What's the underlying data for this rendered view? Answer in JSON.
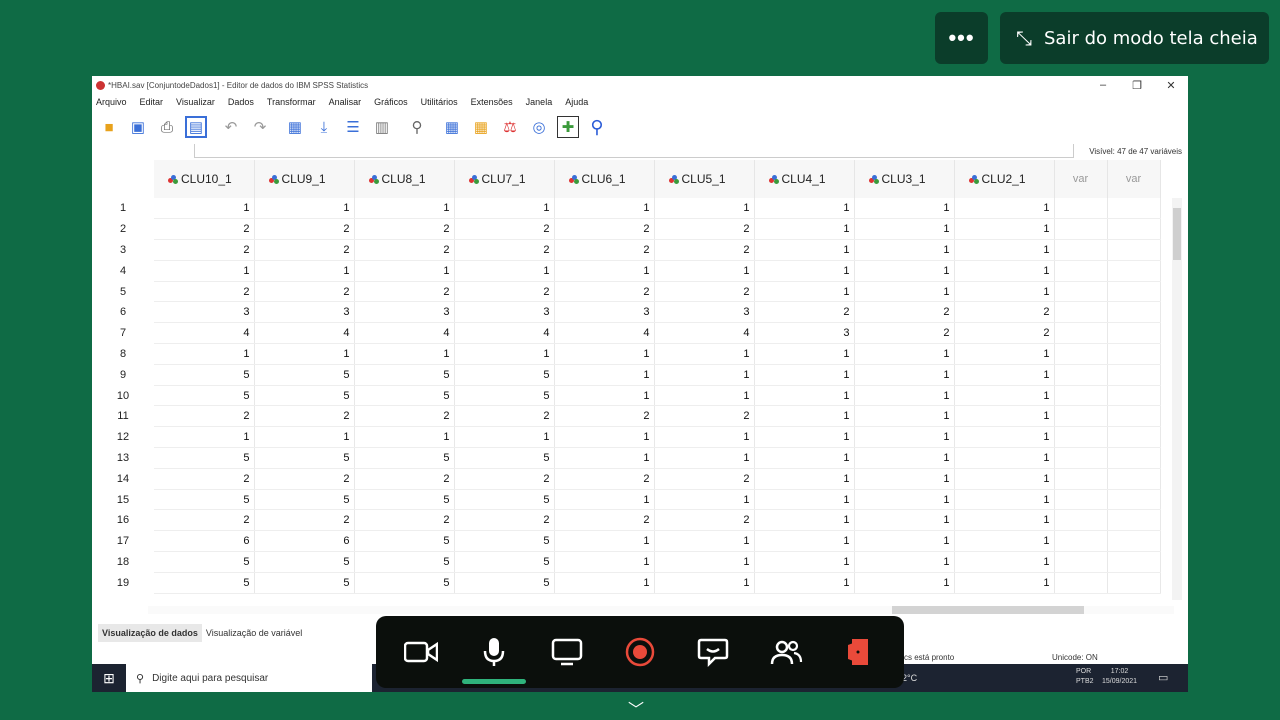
{
  "meeting": {
    "more_label": "•••",
    "exit_fullscreen_label": "Sair do modo tela cheia"
  },
  "window": {
    "title": "*HBAI.sav [ConjuntodeDados1] - Editor de dados do IBM SPSS Statistics",
    "menu": [
      "Arquivo",
      "Editar",
      "Visualizar",
      "Dados",
      "Transformar",
      "Analisar",
      "Gráficos",
      "Utilitários",
      "Extensões",
      "Janela",
      "Ajuda"
    ],
    "visible_vars": "Visível: 47 de 47 variáveis"
  },
  "grid": {
    "columns": [
      "CLU10_1",
      "CLU9_1",
      "CLU8_1",
      "CLU7_1",
      "CLU6_1",
      "CLU5_1",
      "CLU4_1",
      "CLU3_1",
      "CLU2_1"
    ],
    "empty_columns": [
      "var",
      "var"
    ],
    "rows": [
      {
        "n": "1",
        "v": [
          1,
          1,
          1,
          1,
          1,
          1,
          1,
          1,
          1
        ]
      },
      {
        "n": "2",
        "v": [
          2,
          2,
          2,
          2,
          2,
          2,
          1,
          1,
          1
        ]
      },
      {
        "n": "3",
        "v": [
          2,
          2,
          2,
          2,
          2,
          2,
          1,
          1,
          1
        ]
      },
      {
        "n": "4",
        "v": [
          1,
          1,
          1,
          1,
          1,
          1,
          1,
          1,
          1
        ]
      },
      {
        "n": "5",
        "v": [
          2,
          2,
          2,
          2,
          2,
          2,
          1,
          1,
          1
        ]
      },
      {
        "n": "6",
        "v": [
          3,
          3,
          3,
          3,
          3,
          3,
          2,
          2,
          2
        ]
      },
      {
        "n": "7",
        "v": [
          4,
          4,
          4,
          4,
          4,
          4,
          3,
          2,
          2
        ]
      },
      {
        "n": "8",
        "v": [
          1,
          1,
          1,
          1,
          1,
          1,
          1,
          1,
          1
        ]
      },
      {
        "n": "9",
        "v": [
          5,
          5,
          5,
          5,
          1,
          1,
          1,
          1,
          1
        ]
      },
      {
        "n": "10",
        "v": [
          5,
          5,
          5,
          5,
          1,
          1,
          1,
          1,
          1
        ]
      },
      {
        "n": "11",
        "v": [
          2,
          2,
          2,
          2,
          2,
          2,
          1,
          1,
          1
        ]
      },
      {
        "n": "12",
        "v": [
          1,
          1,
          1,
          1,
          1,
          1,
          1,
          1,
          1
        ]
      },
      {
        "n": "13",
        "v": [
          5,
          5,
          5,
          5,
          1,
          1,
          1,
          1,
          1
        ]
      },
      {
        "n": "14",
        "v": [
          2,
          2,
          2,
          2,
          2,
          2,
          1,
          1,
          1
        ]
      },
      {
        "n": "15",
        "v": [
          5,
          5,
          5,
          5,
          1,
          1,
          1,
          1,
          1
        ]
      },
      {
        "n": "16",
        "v": [
          2,
          2,
          2,
          2,
          2,
          2,
          1,
          1,
          1
        ]
      },
      {
        "n": "17",
        "v": [
          6,
          6,
          5,
          5,
          1,
          1,
          1,
          1,
          1
        ]
      },
      {
        "n": "18",
        "v": [
          5,
          5,
          5,
          5,
          1,
          1,
          1,
          1,
          1
        ]
      },
      {
        "n": "19",
        "v": [
          5,
          5,
          5,
          5,
          1,
          1,
          1,
          1,
          1
        ]
      }
    ]
  },
  "tabs": [
    "Visualização de dados",
    "Visualização de variável"
  ],
  "status": {
    "ready": "tics  está pronto",
    "unicode": "Unicode: ON"
  },
  "taskbar": {
    "search_placeholder": "Digite aqui para pesquisar",
    "temp": "2°C",
    "lang1": "POR",
    "lang2": "PTB2",
    "time": "17:02",
    "date": "15/09/2021"
  }
}
